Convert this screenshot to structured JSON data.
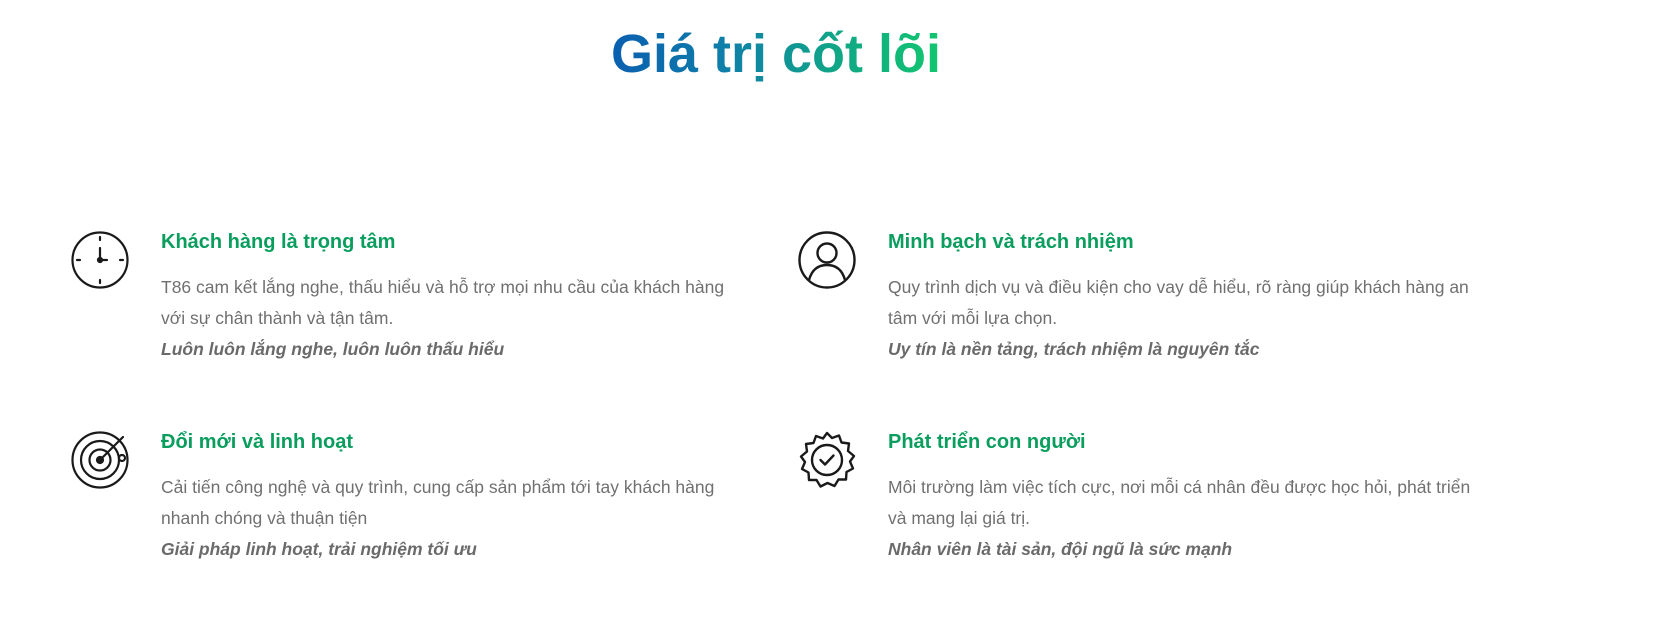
{
  "title": "Giá trị cốt lõi",
  "colors": {
    "title_gradient_start": "#0a5eb0",
    "title_gradient_end": "#12c76f",
    "heading": "#0a9e5e",
    "body_text": "#707070",
    "icon_stroke": "#1a1a1a"
  },
  "values": [
    {
      "icon": "clock-icon",
      "heading": "Khách hàng là trọng tâm",
      "description": "T86 cam kết lắng nghe, thấu hiểu và hỗ trợ mọi nhu cầu của khách hàng với sự chân thành và tận tâm.",
      "motto": "Luôn luôn lắng nghe, luôn luôn thấu hiểu"
    },
    {
      "icon": "user-icon",
      "heading": "Minh bạch và trách nhiệm",
      "description": "Quy trình dịch vụ và điều kiện cho vay dễ hiểu, rõ ràng giúp khách hàng an tâm với mỗi lựa chọn.",
      "motto": "Uy tín là nền tảng, trách nhiệm là nguyên tắc"
    },
    {
      "icon": "radar-icon",
      "heading": "Đổi mới và linh hoạt",
      "description": "Cải tiến công nghệ và quy trình, cung cấp sản phẩm tới tay khách hàng nhanh chóng và thuận tiện",
      "motto": "Giải pháp linh hoạt, trải nghiệm tối ưu"
    },
    {
      "icon": "badge-check-icon",
      "heading": "Phát triển con người",
      "description": "Môi trường làm việc tích cực, nơi mỗi cá nhân đều được học hỏi, phát triển và mang lại giá trị.",
      "motto": "Nhân viên là tài sản, đội ngũ là sức mạnh"
    }
  ]
}
